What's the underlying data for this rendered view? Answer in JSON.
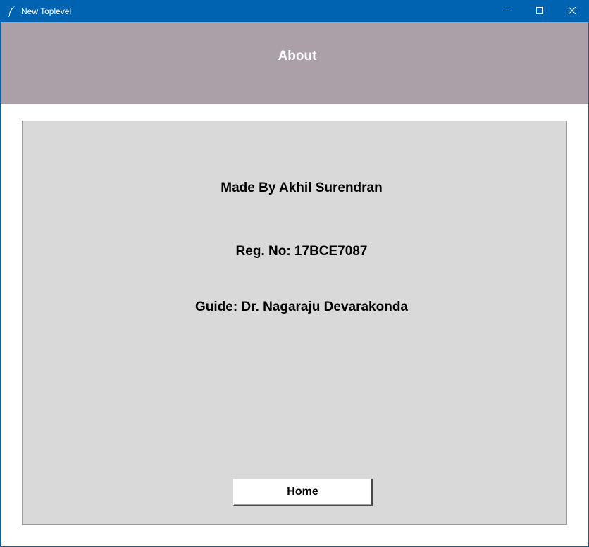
{
  "window": {
    "title": "New Toplevel",
    "controls": {
      "minimize_icon": "minimize-icon",
      "maximize_icon": "maximize-icon",
      "close_icon": "close-icon"
    }
  },
  "header": {
    "title": "About"
  },
  "panel": {
    "made_by": "Made By Akhil Surendran",
    "reg_no": "Reg. No: 17BCE7087",
    "guide": "Guide: Dr. Nagaraju Devarakonda"
  },
  "buttons": {
    "home_label": "Home"
  },
  "colors": {
    "titlebar": "#0063b1",
    "header_bg": "#aba0a8",
    "panel_bg": "#d9d9d9",
    "window_bg": "#ffffff"
  }
}
